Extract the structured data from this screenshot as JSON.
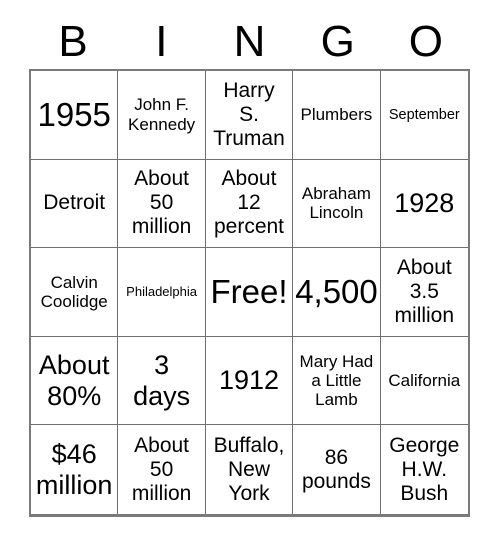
{
  "card": {
    "type": "bingo-card",
    "columns": 5,
    "rows": 5,
    "header": {
      "letters": [
        "B",
        "I",
        "N",
        "G",
        "O"
      ]
    },
    "free_space": {
      "label": "Free!",
      "row": 3,
      "column": 3
    },
    "cells": [
      {
        "text": "1955",
        "size": "fs-xl"
      },
      {
        "text": "John F.\nKennedy",
        "size": "fs-sm"
      },
      {
        "text": "Harry\nS.\nTruman",
        "size": "fs-md"
      },
      {
        "text": "Plumbers",
        "size": "fs-sm"
      },
      {
        "text": "September",
        "size": "fs-xs"
      },
      {
        "text": "Detroit",
        "size": "fs-md"
      },
      {
        "text": "About\n50\nmillion",
        "size": "fs-md"
      },
      {
        "text": "About\n12\npercent",
        "size": "fs-md"
      },
      {
        "text": "Abraham\nLincoln",
        "size": "fs-sm"
      },
      {
        "text": "1928",
        "size": "fs-lg"
      },
      {
        "text": "Calvin\nCoolidge",
        "size": "fs-sm"
      },
      {
        "text": "Philadelphia",
        "size": "fs-xxs"
      },
      {
        "text": "Free!",
        "size": "fs-xl"
      },
      {
        "text": "4,500",
        "size": "fs-xl"
      },
      {
        "text": "About\n3.5\nmillion",
        "size": "fs-md"
      },
      {
        "text": "About\n80%",
        "size": "fs-lg"
      },
      {
        "text": "3\ndays",
        "size": "fs-lg"
      },
      {
        "text": "1912",
        "size": "fs-lg"
      },
      {
        "text": "Mary Had\na Little\nLamb",
        "size": "fs-sm"
      },
      {
        "text": "California",
        "size": "fs-sm"
      },
      {
        "text": "$46\nmillion",
        "size": "fs-lg"
      },
      {
        "text": "About\n50\nmillion",
        "size": "fs-md"
      },
      {
        "text": "Buffalo,\nNew\nYork",
        "size": "fs-md"
      },
      {
        "text": "86\npounds",
        "size": "fs-md"
      },
      {
        "text": "George\nH.W.\nBush",
        "size": "fs-md"
      }
    ]
  },
  "colors": {
    "background": "#ffffff",
    "text": "#000000",
    "grid_line": "#6e6e6e",
    "grid_outer": "#7a7a7a"
  }
}
